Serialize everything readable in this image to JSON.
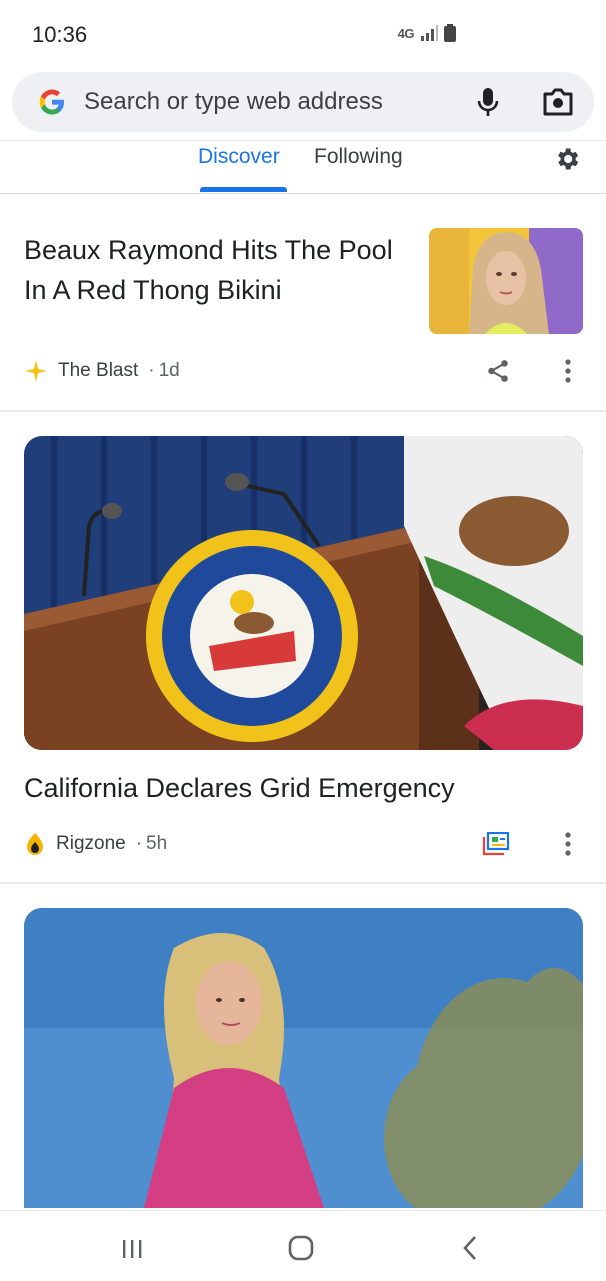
{
  "status": {
    "time": "10:36",
    "network": "4G"
  },
  "search": {
    "placeholder": "Search or type web address"
  },
  "tabs": [
    {
      "label": "Discover",
      "active": true
    },
    {
      "label": "Following",
      "active": false
    }
  ],
  "feed": [
    {
      "headline": "Beaux Raymond Hits The Pool In A Red Thong Bikini",
      "source": "The Blast",
      "age": "1d",
      "icon": "sparkle-icon",
      "thumb": "portrait-photo"
    },
    {
      "headline": "California Declares Grid Emergency",
      "source": "Rigzone",
      "age": "5h",
      "icon": "flame-icon",
      "image": "press-podium-with-california-seal"
    },
    {
      "image": "woman-in-pink-sweater-outdoors"
    }
  ],
  "colors": {
    "accent": "#1a73e8",
    "text": "#202124",
    "muted": "#5f6368"
  }
}
